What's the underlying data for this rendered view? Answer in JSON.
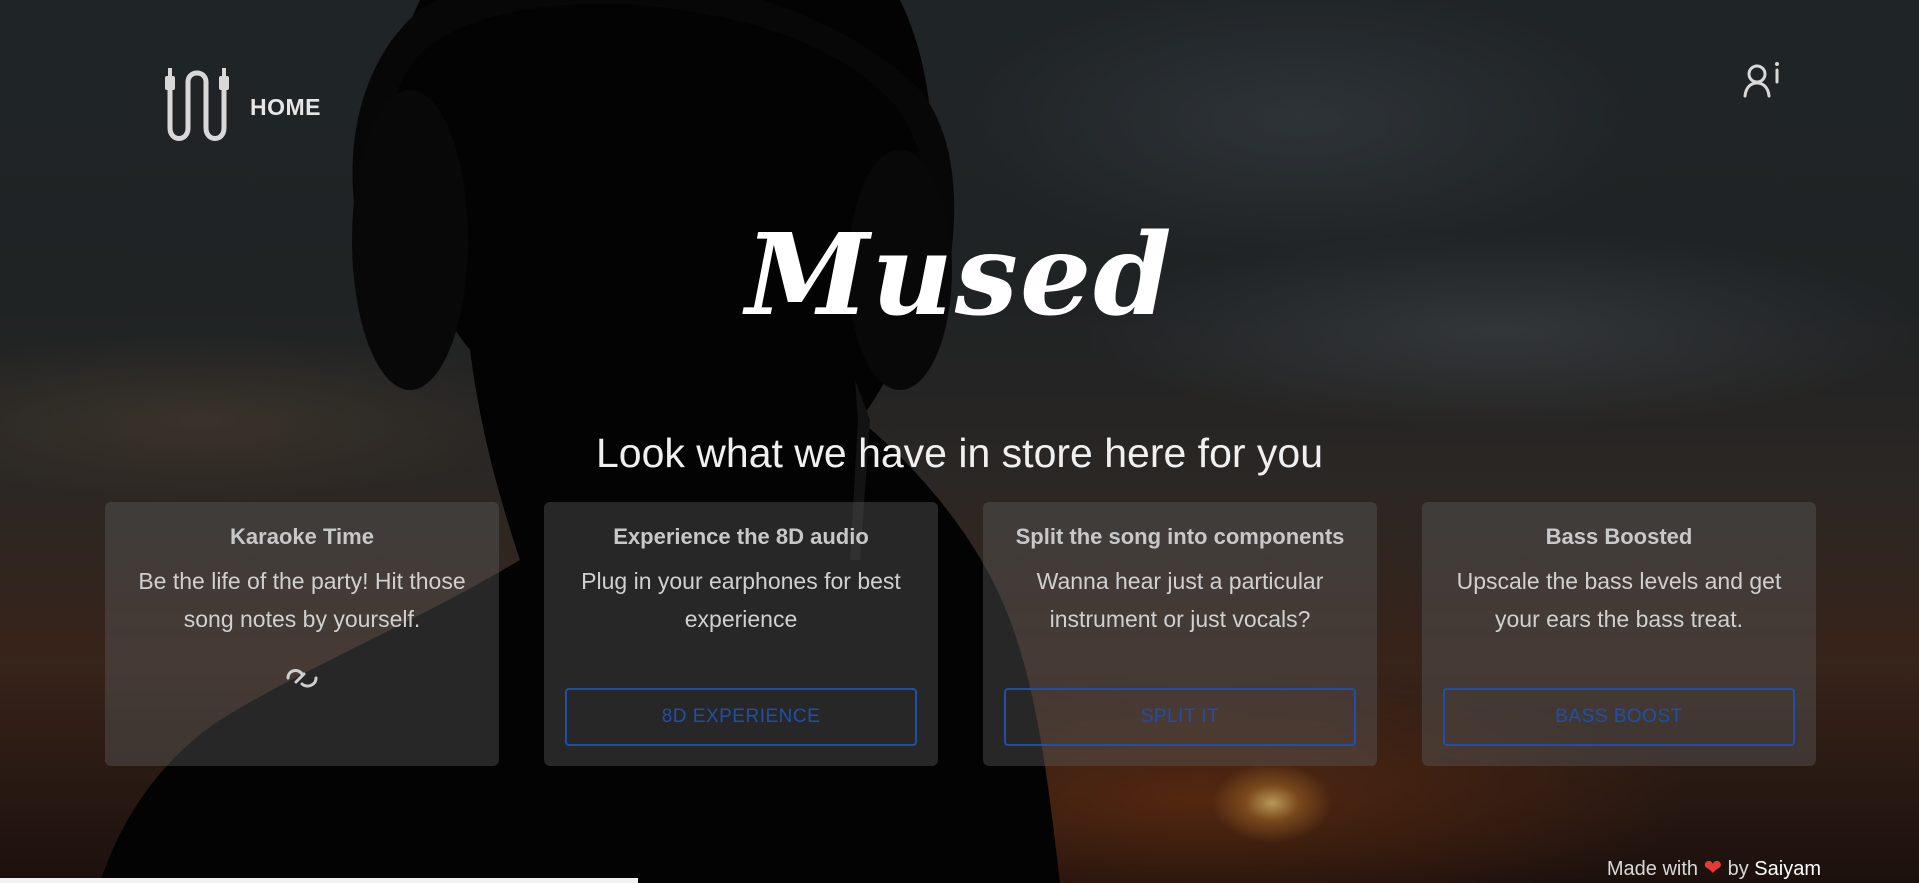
{
  "nav": {
    "home_label": "HOME"
  },
  "hero": {
    "brand": "Mused",
    "tagline": "Look what we have in store here for you"
  },
  "cards": [
    {
      "title": "Karaoke Time",
      "description": "Be the life of the party! Hit those song notes by yourself.",
      "button_label": ""
    },
    {
      "title": "Experience the 8D audio",
      "description": "Plug in your earphones for best experience",
      "button_label": "8D EXPERIENCE"
    },
    {
      "title": "Split the song into components",
      "description": "Wanna hear just a particular instrument or just vocals?",
      "button_label": "SPLIT IT"
    },
    {
      "title": "Bass Boosted",
      "description": "Upscale the bass levels and get your ears the bass treat.",
      "button_label": "BASS BOOST"
    }
  ],
  "footer": {
    "made_with": "Made with",
    "heart": "❤",
    "by": "by",
    "author": "Saiyam"
  },
  "colors": {
    "button_accent": "#1f4fa8",
    "heart": "#e53935",
    "card_bg": "rgba(90,90,90,0.42)"
  },
  "icons": {
    "logo": "audio-cable-logo-icon",
    "user": "user-info-icon",
    "loading": "loading-spinner-icon"
  }
}
